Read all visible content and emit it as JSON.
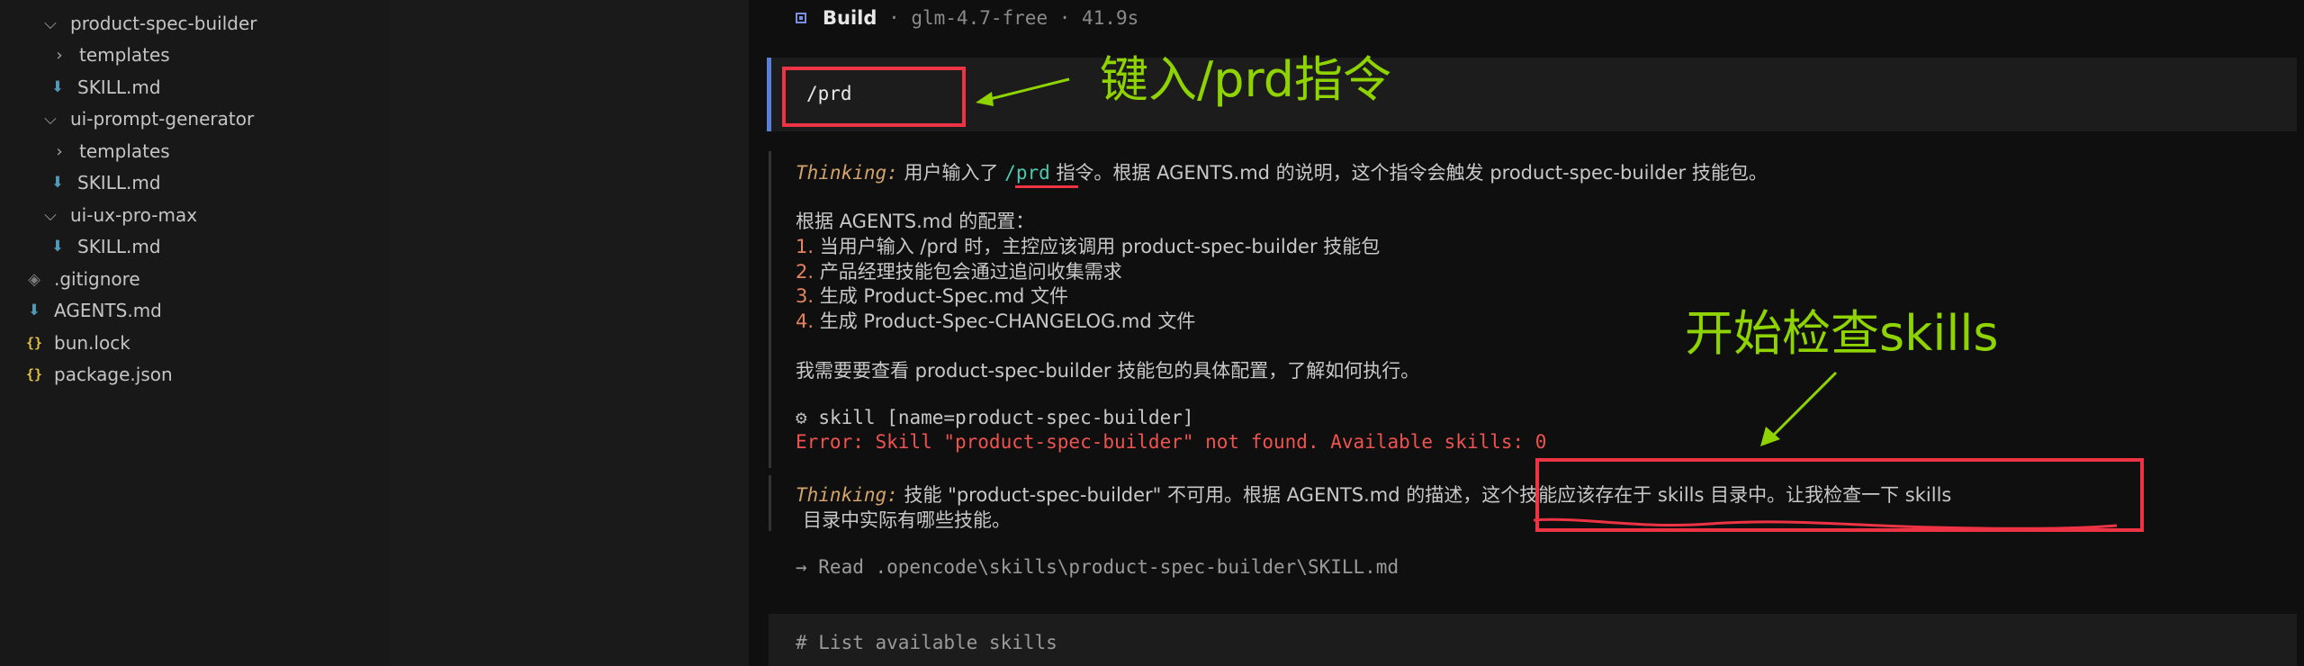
{
  "explorer": {
    "items": [
      {
        "label": "product-spec-builder",
        "icon": "chevron-down-icon"
      },
      {
        "label": "templates",
        "icon": "chevron-right-icon"
      },
      {
        "label": "SKILL.md",
        "icon": "markdown-icon"
      },
      {
        "label": "ui-prompt-generator",
        "icon": "chevron-down-icon"
      },
      {
        "label": "templates",
        "icon": "chevron-right-icon"
      },
      {
        "label": "SKILL.md",
        "icon": "markdown-icon"
      },
      {
        "label": "ui-ux-pro-max",
        "icon": "chevron-down-icon"
      },
      {
        "label": "SKILL.md",
        "icon": "markdown-icon"
      },
      {
        "label": ".gitignore",
        "icon": "git-icon"
      },
      {
        "label": "AGENTS.md",
        "icon": "markdown-icon"
      },
      {
        "label": "bun.lock",
        "icon": "json-braces-icon"
      },
      {
        "label": "package.json",
        "icon": "json-braces-icon"
      }
    ]
  },
  "chat": {
    "build_header": {
      "label": "Build",
      "meta": "· glm-4.7-free · 41.9s"
    },
    "user_message": "/prd",
    "thinking_label": "Thinking:",
    "thinking1": {
      "pre": "用户输入了",
      "cmd": "/prd",
      "post": "指令。根据 AGENTS.md 的说明，这个指令会触发 product-spec-builder 技能包。"
    },
    "config_heading": "根据 AGENTS.md 的配置：",
    "config_list": [
      {
        "num": "1.",
        "text": "当用户输入 /prd 时，主控应该调用 product-spec-builder 技能包"
      },
      {
        "num": "2.",
        "text": "产品经理技能包会通过追问收集需求"
      },
      {
        "num": "3.",
        "text": "生成 Product-Spec.md 文件"
      },
      {
        "num": "4.",
        "text": "生成 Product-Spec-CHANGELOG.md 文件"
      }
    ],
    "need_check": "我需要要查看 product-spec-builder 技能包的具体配置，了解如何执行。",
    "skill_call": "skill [name=product-spec-builder]",
    "skill_error": "Error: Skill \"product-spec-builder\" not found. Available skills: 0",
    "thinking2_line1": "技能 \"product-spec-builder\" 不可用。根据 AGENTS.md 的描述，这个技能应该存在于 skills 目录中。让我检查一下 skills",
    "thinking2_line2": "目录中实际有哪些技能。",
    "read_action": "→ Read .opencode\\skills\\product-spec-builder\\SKILL.md",
    "code_comment": "# List available skills"
  },
  "annotations": {
    "note_prd": "键入/prd指令",
    "note_skills": "开始检查skills"
  },
  "colors": {
    "annotation_box": "#ee3344",
    "annotation_text": "#8fd400",
    "error": "#ef5350",
    "thinking_label": "#d2a26a",
    "list_number": "#e5845f",
    "user_bar": "#5b7fd6"
  }
}
